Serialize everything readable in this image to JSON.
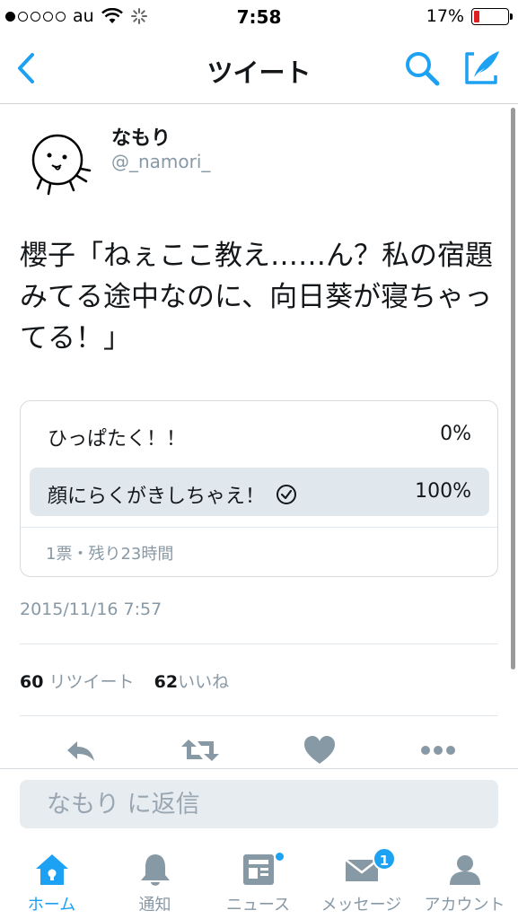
{
  "status_bar": {
    "carrier": "au",
    "time": "7:58",
    "battery": "17%",
    "battery_level": 0.17
  },
  "nav": {
    "title": "ツイート"
  },
  "tweet": {
    "name": "なもり",
    "handle": "@_namori_",
    "text": "櫻子「ねぇここ教え……ん？私の宿題みてる途中なのに、向日葵が寝ちゃってる！」",
    "timestamp": "2015/11/16 7:57"
  },
  "poll": {
    "options": [
      {
        "label": "ひっぱたく！！",
        "percent": "0%",
        "fraction": 0.0
      },
      {
        "label": "顔にらくがきしちゃえ！",
        "percent": "100%",
        "fraction": 1.0
      }
    ],
    "meta": "1票・残り23時間"
  },
  "stats": {
    "retweets": "60",
    "retweets_label": "リツイート",
    "likes": "62",
    "likes_label": "いいね"
  },
  "reply": {
    "placeholder": "なもり に返信"
  },
  "tabs": [
    {
      "label": "ホーム",
      "icon": "home-icon",
      "active": true
    },
    {
      "label": "通知",
      "icon": "bell-icon"
    },
    {
      "label": "ニュース",
      "icon": "news-icon"
    },
    {
      "label": "メッセージ",
      "icon": "envelope-icon",
      "badge": "1"
    },
    {
      "label": "アカウント",
      "icon": "person-icon"
    }
  ],
  "colors": {
    "accent": "#1da1f2",
    "muted": "#8899a6",
    "text": "#14171a",
    "poll_bar": "#e1e8ed"
  }
}
